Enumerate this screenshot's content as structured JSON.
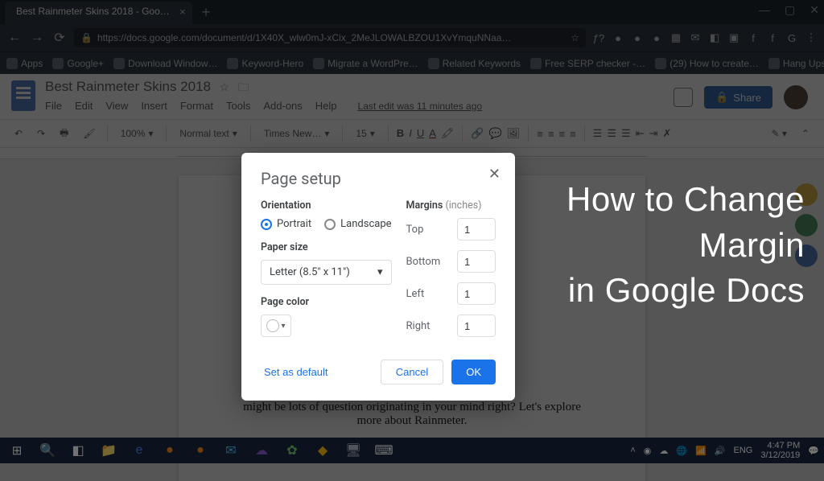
{
  "browser": {
    "tab_title": "Best Rainmeter Skins 2018 - Goo…",
    "url": "https://docs.google.com/document/d/1X40X_wlw0mJ-xCix_2MeJLOWALBZOU1XvYmquNNaa…",
    "bookmarks": [
      "Apps",
      "Google+",
      "Download Window…",
      "Keyword-Hero",
      "Migrate a WordPre…",
      "Related Keywords",
      "Free SERP checker -…",
      "(29) How to create…",
      "Hang Ups (Want Yo…"
    ]
  },
  "docs": {
    "title": "Best Rainmeter Skins 2018",
    "menus": [
      "File",
      "Edit",
      "View",
      "Insert",
      "Format",
      "Tools",
      "Add-ons",
      "Help"
    ],
    "last_edit": "Last edit was 11 minutes ago",
    "share_label": "Share",
    "toolbar": {
      "zoom": "100%",
      "style": "Normal text",
      "font": "Times New…",
      "size": "15"
    },
    "page": {
      "frag": "might be lots of question originating in your mind right? Let's explore more about Rainmeter."
    }
  },
  "dialog": {
    "title": "Page setup",
    "orientation_label": "Orientation",
    "portrait": "Portrait",
    "landscape": "Landscape",
    "paper_size_label": "Paper size",
    "paper_size_value": "Letter (8.5\" x 11\")",
    "page_color_label": "Page color",
    "margins_label": "Margins",
    "margins_unit": "(inches)",
    "margins": {
      "top_label": "Top",
      "top_value": "1",
      "bottom_label": "Bottom",
      "bottom_value": "1",
      "left_label": "Left",
      "left_value": "1",
      "right_label": "Right",
      "right_value": "1"
    },
    "set_default": "Set as default",
    "cancel": "Cancel",
    "ok": "OK"
  },
  "overlay": {
    "line1": "How to Change",
    "line2": "Margin",
    "line3": "in Google Docs"
  },
  "tray": {
    "time": "4:47 PM",
    "date": "3/12/2019"
  }
}
